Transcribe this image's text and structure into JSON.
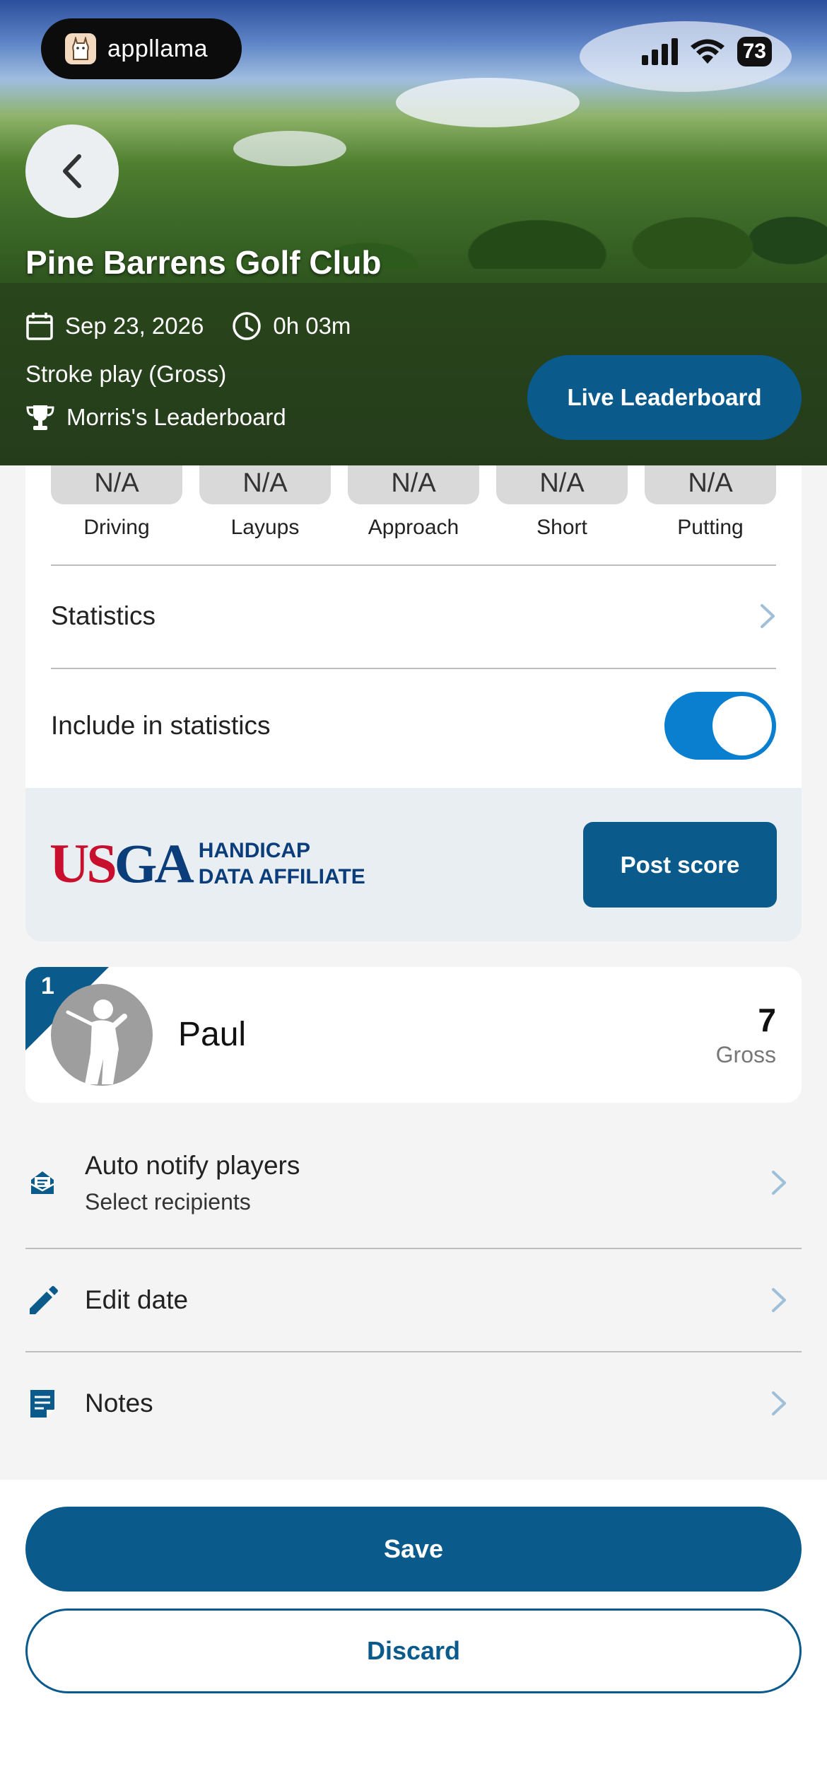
{
  "brand": {
    "name": "appllama"
  },
  "status_bar": {
    "battery": "73"
  },
  "round": {
    "club": "Pine Barrens Golf Club",
    "date": "Sep 23, 2026",
    "duration": "0h 03m",
    "format": "Stroke play (Gross)",
    "leaderboard": "Morris's Leaderboard",
    "live_button": "Live Leaderboard"
  },
  "strokes_gained": [
    {
      "value": "N/A",
      "label": "Driving"
    },
    {
      "value": "N/A",
      "label": "Layups"
    },
    {
      "value": "N/A",
      "label": "Approach"
    },
    {
      "value": "N/A",
      "label": "Short"
    },
    {
      "value": "N/A",
      "label": "Putting"
    }
  ],
  "statistics_label": "Statistics",
  "include_stats": {
    "label": "Include in statistics",
    "enabled": true
  },
  "usga": {
    "mark_red": "US",
    "mark_blue": "GA",
    "line1": "HANDICAP",
    "line2": "DATA AFFILIATE",
    "post_button": "Post score"
  },
  "player": {
    "rank": "1",
    "name": "Paul",
    "score": "7",
    "score_label": "Gross"
  },
  "menu": [
    {
      "title": "Auto notify players",
      "subtitle": "Select recipients",
      "icon": "notify-icon"
    },
    {
      "title": "Edit date",
      "icon": "pencil-icon"
    },
    {
      "title": "Notes",
      "icon": "notes-icon"
    }
  ],
  "actions": {
    "save": "Save",
    "discard": "Discard"
  },
  "colors": {
    "primary": "#0b5a8c",
    "toggle": "#0a7fd0",
    "usga_red": "#c8102e",
    "usga_blue": "#0a3d7a"
  }
}
